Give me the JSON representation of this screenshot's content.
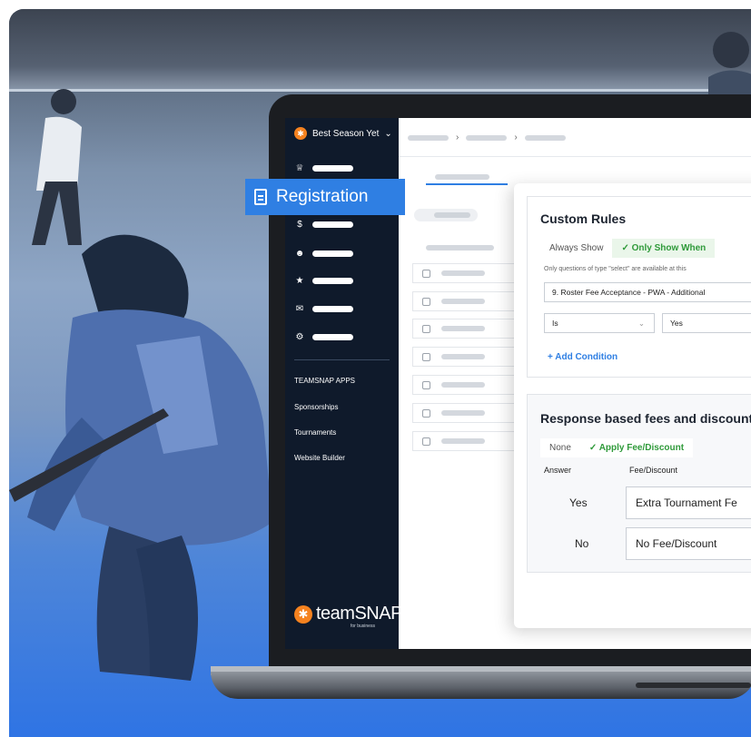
{
  "header": {
    "season_label": "Best Season Yet",
    "season_chevron": "chevron-down-icon"
  },
  "sidebar": {
    "items": [
      {
        "icon": "trophy-icon"
      },
      {
        "icon": "dollar-icon"
      },
      {
        "icon": "users-icon"
      },
      {
        "icon": "star-icon"
      },
      {
        "icon": "mail-icon"
      },
      {
        "icon": "gear-icon"
      }
    ],
    "registration_label": "Registration",
    "apps_heading": "TEAMSNAP APPS",
    "apps": [
      "Sponsorships",
      "Tournaments",
      "Website Builder"
    ],
    "brand_word": "teamSNAP",
    "brand_sub": "for business"
  },
  "custom_rules": {
    "title": "Custom Rules",
    "tab_always": "Always Show",
    "tab_only": "✓ Only Show When",
    "note": "Only questions of type \"select\" are available at this",
    "question_value": "9. Roster Fee Acceptance - PWA - Additional",
    "operator_value": "Is",
    "answer_value": "Yes",
    "add_condition": "+ Add Condition"
  },
  "fees": {
    "title": "Response based fees and discount",
    "tab_none": "None",
    "tab_apply": "✓ Apply Fee/Discount",
    "col_answer": "Answer",
    "col_fee": "Fee/Discount",
    "rows": [
      {
        "answer": "Yes",
        "fee": "Extra Tournament Fe"
      },
      {
        "answer": "No",
        "fee": "No Fee/Discount"
      }
    ]
  },
  "colors": {
    "sidebar_bg": "#0f1a2b",
    "accent_blue": "#2f7fe3",
    "brand_orange": "#f5821f",
    "success_green": "#2f9a3a"
  }
}
